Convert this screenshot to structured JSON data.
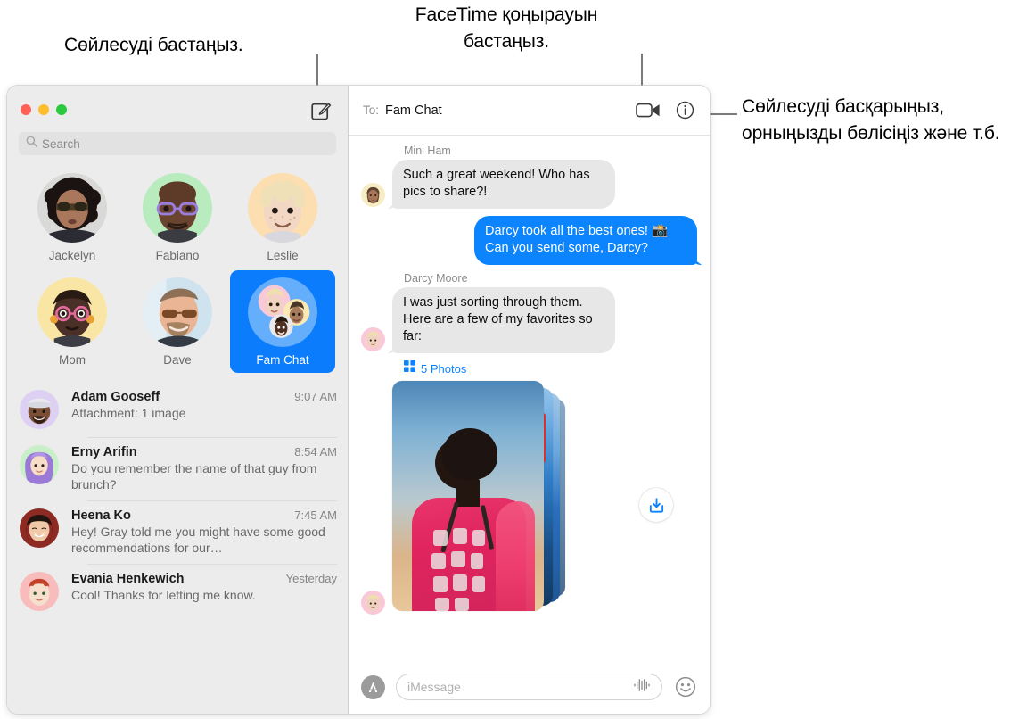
{
  "annotations": {
    "start_conversation": "Сөйлесуді бастаңыз.",
    "facetime_call": "FaceTime қоңырауын бастаңыз.",
    "manage_conversation": "Сөйлесуді басқарыңыз, орныңызды бөлісіңіз және т.б."
  },
  "window": {
    "traffic_lights": [
      "close",
      "minimize",
      "zoom"
    ]
  },
  "sidebar": {
    "compose_icon": "compose-icon",
    "search": {
      "placeholder": "Search",
      "value": "",
      "icon": "search-icon"
    },
    "pinned": [
      {
        "label": "Jackelyn",
        "selected": false
      },
      {
        "label": "Fabiano",
        "selected": false
      },
      {
        "label": "Leslie",
        "selected": false
      },
      {
        "label": "Mom",
        "selected": false
      },
      {
        "label": "Dave",
        "selected": false
      },
      {
        "label": "Fam Chat",
        "selected": true
      }
    ],
    "conversations": [
      {
        "name": "Adam Gooseff",
        "time": "9:07 AM",
        "preview": "Attachment: 1 image"
      },
      {
        "name": "Erny Arifin",
        "time": "8:54 AM",
        "preview": "Do you remember the name of that guy from brunch?"
      },
      {
        "name": "Heena Ko",
        "time": "7:45 AM",
        "preview": "Hey! Gray told me you might have some good recommendations for our…"
      },
      {
        "name": "Evania Henkewich",
        "time": "Yesterday",
        "preview": "Cool! Thanks for letting me know."
      }
    ]
  },
  "thread": {
    "to_label": "To:",
    "to_value": "Fam Chat",
    "actions": [
      {
        "name": "facetime-video-button",
        "icon": "video-camera-icon"
      },
      {
        "name": "details-info-button",
        "icon": "info-circle-icon"
      }
    ],
    "messages": [
      {
        "sender": "Mini Ham",
        "direction": "in",
        "text": "Such a great weekend! Who has pics to share?!"
      },
      {
        "sender": "",
        "direction": "out",
        "text": "Darcy took all the best ones! 📸 Can you send some, Darcy?"
      },
      {
        "sender": "Darcy Moore",
        "direction": "in",
        "text": "I was just sorting through them. Here are a few of my favorites so far:"
      }
    ],
    "attachment": {
      "count_label": "5 Photos",
      "grid_icon": "grid-icon",
      "download_icon": "download-icon"
    }
  },
  "compose": {
    "apps_icon": "app-store-icon",
    "placeholder": "iMessage",
    "value": "",
    "audio_icon": "audio-waveform-icon",
    "emoji_icon": "smiley-face-icon"
  },
  "colors": {
    "accent_blue": "#0b84fe",
    "selected_tile": "#0b7cfb",
    "incoming_bubble": "#e7e7e8",
    "window_chrome": "#ececec",
    "traffic_red": "#ff6159",
    "traffic_yellow": "#ffbd2e",
    "traffic_green": "#2bc840"
  }
}
